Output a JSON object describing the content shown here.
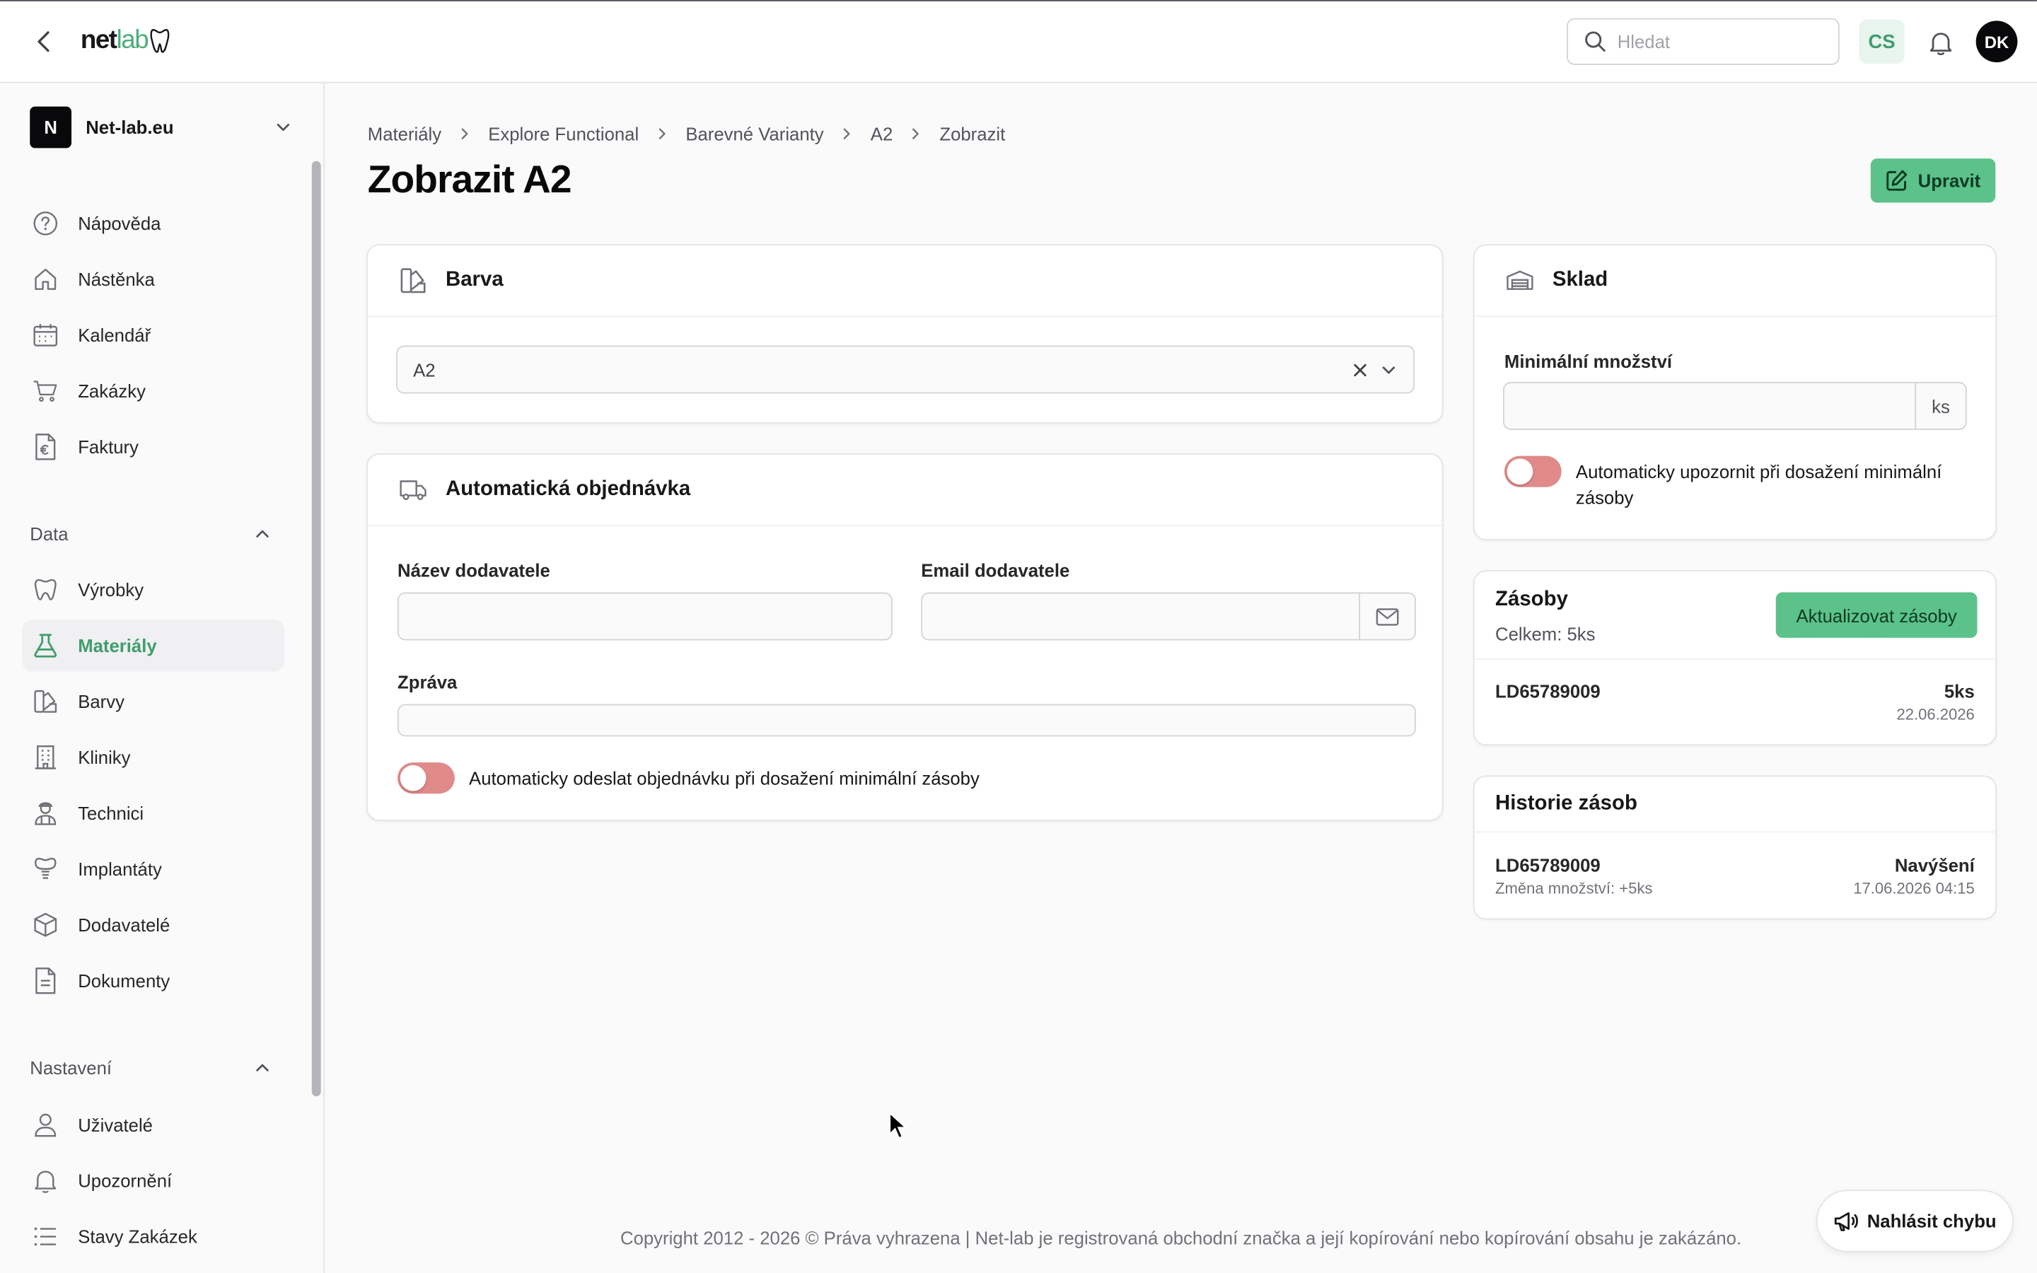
{
  "app": {
    "logo_part1": "net",
    "logo_part2": "lab"
  },
  "header": {
    "search_placeholder": "Hledat",
    "language": "CS",
    "user_initials": "DK"
  },
  "sidebar": {
    "org_initial": "N",
    "org_name": "Net-lab.eu",
    "main_items": [
      {
        "label": "Nápověda",
        "icon": "help-circle-icon"
      },
      {
        "label": "Nástěnka",
        "icon": "home-icon"
      },
      {
        "label": "Kalendář",
        "icon": "calendar-icon"
      },
      {
        "label": "Zakázky",
        "icon": "cart-icon"
      },
      {
        "label": "Faktury",
        "icon": "invoice-euro-icon"
      }
    ],
    "data_section": "Data",
    "data_items": [
      {
        "label": "Výrobky",
        "icon": "tooth-icon"
      },
      {
        "label": "Materiály",
        "icon": "flask-icon",
        "active": true
      },
      {
        "label": "Barvy",
        "icon": "swatch-icon"
      },
      {
        "label": "Kliniky",
        "icon": "building-icon"
      },
      {
        "label": "Technici",
        "icon": "technician-icon"
      },
      {
        "label": "Implantáty",
        "icon": "implant-icon"
      },
      {
        "label": "Dodavatelé",
        "icon": "box-icon"
      },
      {
        "label": "Dokumenty",
        "icon": "document-icon"
      }
    ],
    "settings_section": "Nastavení",
    "settings_items": [
      {
        "label": "Uživatelé",
        "icon": "user-icon"
      },
      {
        "label": "Upozornění",
        "icon": "bell-icon"
      },
      {
        "label": "Stavy Zakázek",
        "icon": "list-icon"
      }
    ]
  },
  "breadcrumb": [
    "Materiály",
    "Explore Functional",
    "Barevné Varianty",
    "A2",
    "Zobrazit"
  ],
  "page": {
    "title": "Zobrazit A2",
    "edit_label": "Upravit"
  },
  "barva": {
    "title": "Barva",
    "selected": "A2"
  },
  "auto_order": {
    "title": "Automatická objednávka",
    "supplier_name_label": "Název dodavatele",
    "supplier_name_value": "",
    "supplier_email_label": "Email dodavatele",
    "supplier_email_value": "",
    "message_label": "Zpráva",
    "message_value": "",
    "toggle_label": "Automaticky odeslat objednávku při dosažení minimální zásoby",
    "toggle_on": false
  },
  "sklad": {
    "title": "Sklad",
    "min_qty_label": "Minimální množství",
    "min_qty_value": "",
    "unit": "ks",
    "toggle_label_line1": "Automaticky upozornit při dosažení minimální",
    "toggle_label_line2": "zásoby",
    "toggle_on": false
  },
  "zasoby": {
    "title": "Zásoby",
    "total": "Celkem: 5ks",
    "update_label": "Aktualizovat zásoby",
    "items": [
      {
        "code": "LD65789009",
        "qty": "5ks",
        "date": "22.06.2026"
      }
    ]
  },
  "history": {
    "title": "Historie zásob",
    "items": [
      {
        "code": "LD65789009",
        "change": "Změna množství: +5ks",
        "type": "Navýšení",
        "datetime": "17.06.2026 04:15"
      }
    ]
  },
  "footer": {
    "text": "Copyright 2012 - 2026 © Práva vyhrazena | Net-lab je registrovaná obchodní značka a její kopírování nebo kopírování obsahu je zakázáno."
  },
  "report": {
    "label": "Nahlásit chybu"
  },
  "colors": {
    "accent": "#5bc28a",
    "accent_text": "#3f9d6b",
    "toggle_off": "#e08a8a"
  }
}
